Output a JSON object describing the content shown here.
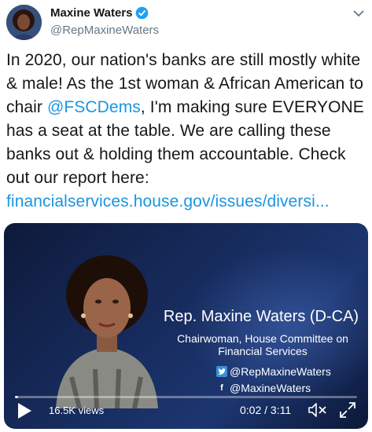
{
  "tweet": {
    "author_name": "Maxine Waters",
    "handle": "@RepMaxineWaters",
    "text_parts": [
      "In 2020, our nation's banks are still mostly white & male! As the 1st woman & African American to chair ",
      "@FSCDems",
      ", I'm making sure EVERYONE has a seat at the table. We are calling these banks out & holding them accountable. Check out our report here: ",
      "financialservices.house.gov/issues/diversi..."
    ]
  },
  "video": {
    "name_title": "Rep. Maxine Waters (D-CA)",
    "role": "Chairwoman, House Committee on Financial Services",
    "twitter_handle": "@RepMaxineWaters",
    "facebook_handle": "@MaxineWaters",
    "views": "16.5K views",
    "time": "0:02 / 3:11",
    "progress": 0.01
  },
  "colors": {
    "link": "#1b95e0",
    "verified": "#1da1f2"
  },
  "icons": [
    "verified-badge-icon",
    "chevron-down-icon",
    "twitter-icon",
    "facebook-icon",
    "play-icon",
    "mute-icon",
    "fullscreen-icon"
  ]
}
